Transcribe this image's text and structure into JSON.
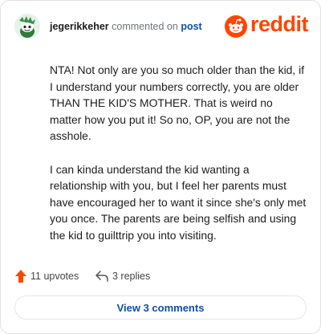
{
  "comment": {
    "username": "jegerikkeher",
    "action": "commented on",
    "post_link": "post",
    "paragraphs": [
      "NTA! Not only are you so much older than the kid, if I understand your numbers correctly, you are older THAN THE KID'S MOTHER. That is weird no matter how you put it! So no, OP, you are not the asshole.",
      "I can kinda understand the kid wanting a relationship with you, but I feel her parents must have encouraged her to want it since she's only met you once. The parents are being selfish and using the kid to guilttrip you into visiting."
    ]
  },
  "brand": {
    "wordmark": "reddit",
    "color": "#ff4500"
  },
  "actions": {
    "upvotes_label": "11 upvotes",
    "replies_label": "3 replies"
  },
  "footer": {
    "view_comments_label": "View 3 comments"
  },
  "icons": [
    "avatar-snoo-icon",
    "reddit-logo-icon",
    "upvote-arrow-icon",
    "reply-arrow-icon"
  ]
}
